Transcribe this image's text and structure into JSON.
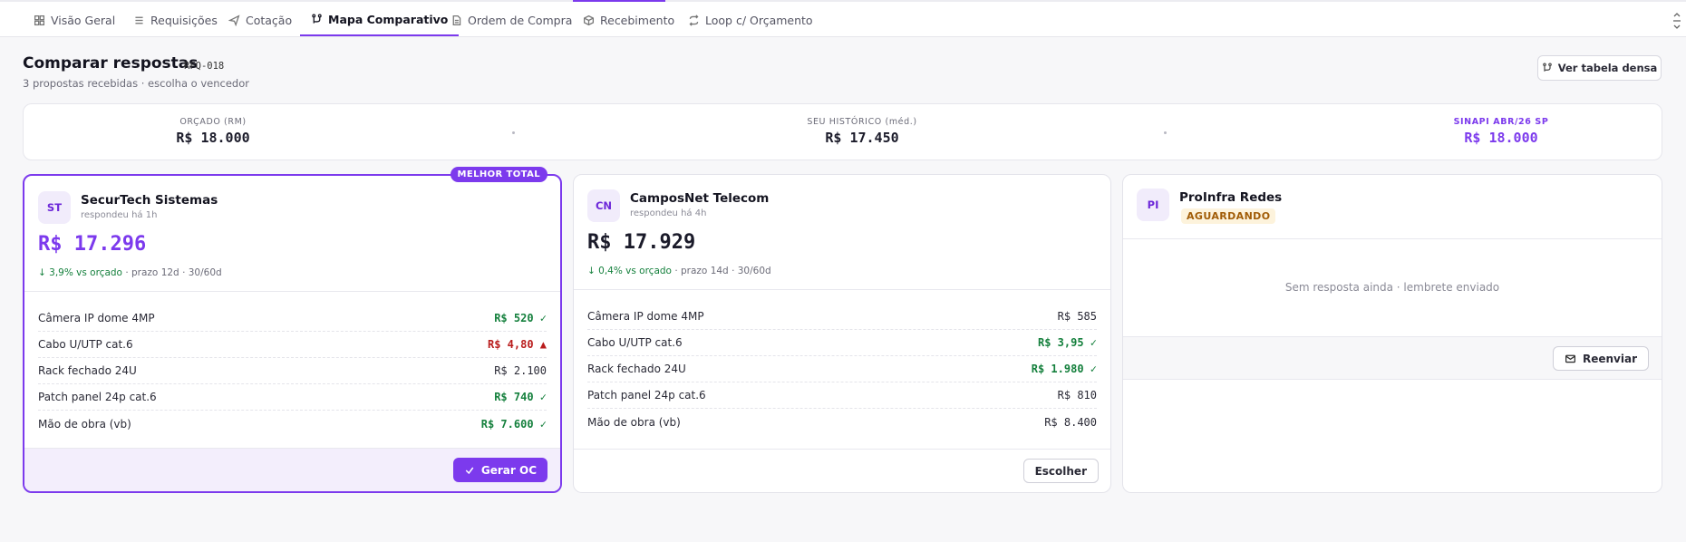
{
  "nav": {
    "tabs": [
      {
        "label": "Visão Geral",
        "icon": "grid-icon"
      },
      {
        "label": "Requisições",
        "icon": "list-icon"
      },
      {
        "label": "Cotação",
        "icon": "send-icon"
      },
      {
        "label": "Mapa Comparativo",
        "icon": "compare-icon"
      },
      {
        "label": "Ordem de Compra",
        "icon": "document-icon"
      },
      {
        "label": "Recebimento",
        "icon": "package-icon"
      },
      {
        "label": "Loop c/ Orçamento",
        "icon": "loop-icon"
      }
    ],
    "active_tab": "Mapa Comparativo"
  },
  "header": {
    "title": "Comparar respostas",
    "code": "RFQ-018",
    "subtitle": "3 propostas recebidas · escolha o vencedor",
    "dense_button": "Ver tabela densa"
  },
  "stats": [
    {
      "label": "ORÇADO (RM)",
      "value": "R$ 18.000"
    },
    {
      "label": "SEU HISTÓRICO (méd.)",
      "value": "R$ 17.450"
    },
    {
      "label": "SINAPI ABR/26 SP",
      "value": "R$ 18.000"
    }
  ],
  "cards": [
    {
      "initials": "ST",
      "name": "SecurTech Sistemas",
      "responded": "respondeu há 1h",
      "total": "R$ 17.296",
      "delta": "↓ 3,9% vs orçado",
      "prazo": "· prazo 12d",
      "pagamento": "· 30/60d",
      "badge": "MELHOR TOTAL",
      "items": [
        {
          "name": "Câmera IP dome 4MP",
          "price": "R$ 520 ✓"
        },
        {
          "name": "Cabo U/UTP cat.6",
          "price": "R$ 4,80 ▲"
        },
        {
          "name": "Rack fechado 24U",
          "price": "R$ 2.100"
        },
        {
          "name": "Patch panel 24p cat.6",
          "price": "R$ 740 ✓"
        },
        {
          "name": "Mão de obra (vb)",
          "price": "R$ 7.600 ✓"
        }
      ],
      "action": "Gerar OC"
    },
    {
      "initials": "CN",
      "name": "CamposNet Telecom",
      "responded": "respondeu há 4h",
      "total": "R$ 17.929",
      "delta": "↓ 0,4% vs orçado",
      "prazo": "· prazo 14d",
      "pagamento": "· 30/60d",
      "items": [
        {
          "name": "Câmera IP dome 4MP",
          "price": "R$ 585"
        },
        {
          "name": "Cabo U/UTP cat.6",
          "price": "R$ 3,95 ✓"
        },
        {
          "name": "Rack fechado 24U",
          "price": "R$ 1.980 ✓"
        },
        {
          "name": "Patch panel 24p cat.6",
          "price": "R$ 810"
        },
        {
          "name": "Mão de obra (vb)",
          "price": "R$ 8.400"
        }
      ],
      "action": "Escolher"
    },
    {
      "initials": "PI",
      "name": "ProInfra Redes",
      "status": "AGUARDANDO",
      "empty_message": "Sem resposta ainda · lembrete enviado",
      "action": "Reenviar"
    }
  ],
  "colors": {
    "accent": "#7c3aed",
    "good": "#15803d",
    "bad": "#b91c1c",
    "warning_bg": "#fdf3dc"
  }
}
